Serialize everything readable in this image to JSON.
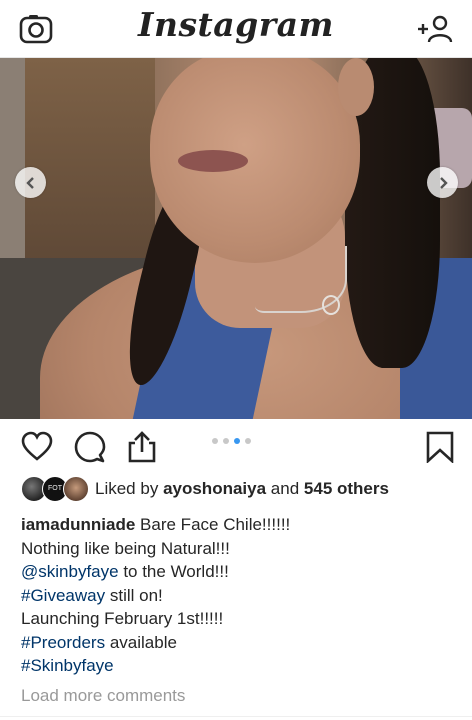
{
  "header": {
    "logo_text": "Instagram",
    "left_icon": "camera-icon",
    "right_icon": "add-person-icon"
  },
  "post": {
    "carousel": {
      "total": 4,
      "current_index": 2,
      "prev_icon": "chevron-left-icon",
      "next_icon": "chevron-right-icon"
    },
    "actions": {
      "like_icon": "heart-icon",
      "comment_icon": "comment-icon",
      "share_icon": "share-icon",
      "save_icon": "bookmark-icon"
    },
    "likes": {
      "prefix": "Liked by",
      "user": "ayoshonaiya",
      "conjunction": "and",
      "others": "545 others",
      "avatar_badge": "FOT"
    },
    "caption": {
      "username": "iamadunniade",
      "line1": "Bare Face Chile!!!!!!",
      "line2": "Nothing like being Natural!!!",
      "mention": "@skinbyfaye",
      "line3_rest": "to the World!!!",
      "hashtag1": "#Giveaway",
      "line4_rest": "still on!",
      "line5": "Launching February 1st!!!!!",
      "hashtag2": "#Preorders",
      "line6_rest": "available",
      "hashtag3": "#Skinbyfaye"
    },
    "load_more": "Load more comments"
  },
  "colors": {
    "link": "#003569",
    "muted": "#999999",
    "active_dot": "#3897f0",
    "inactive_dot": "#c8c8c8"
  }
}
